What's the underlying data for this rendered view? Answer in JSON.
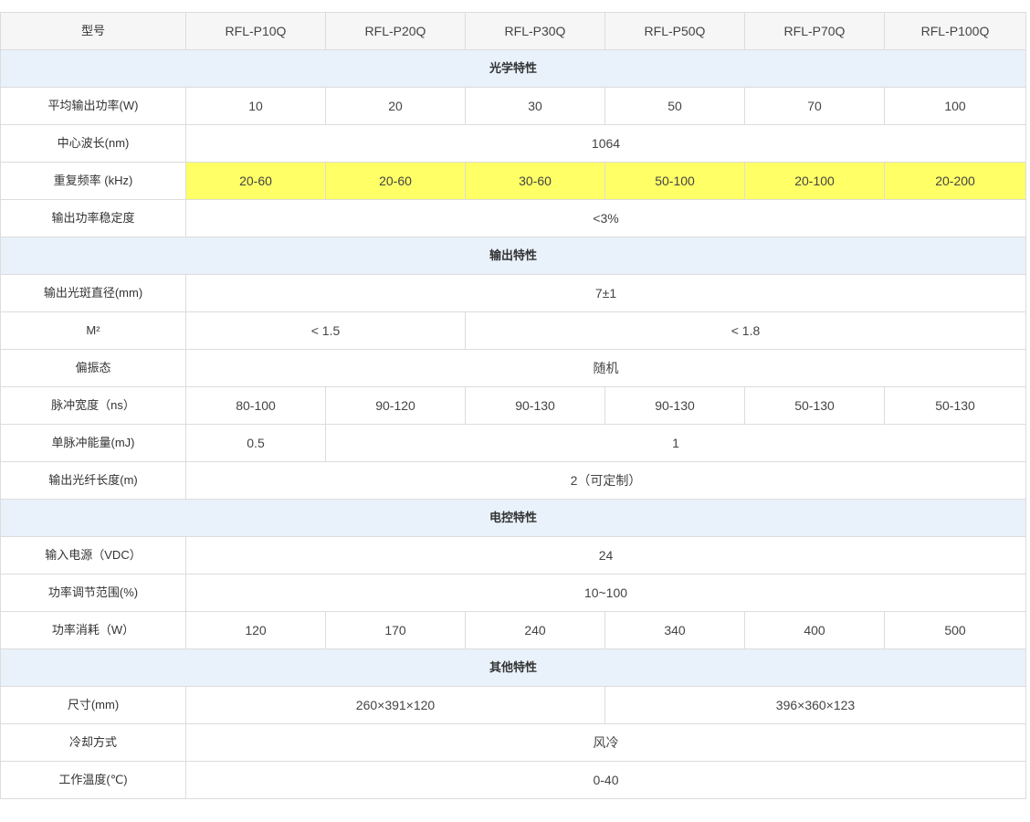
{
  "header": {
    "label": "型号",
    "models": [
      "RFL-P10Q",
      "RFL-P20Q",
      "RFL-P30Q",
      "RFL-P50Q",
      "RFL-P70Q",
      "RFL-P100Q"
    ]
  },
  "sections": {
    "optical": "光学特性",
    "output": "输出特性",
    "electrical": "电控特性",
    "other": "其他特性"
  },
  "rows": {
    "avg_power": {
      "label": "平均输出功率(W)",
      "values": [
        "10",
        "20",
        "30",
        "50",
        "70",
        "100"
      ]
    },
    "center_wavelength": {
      "label": "中心波长(nm)",
      "value": "1064"
    },
    "rep_rate": {
      "label": "重复频率 (kHz)",
      "values": [
        "20-60",
        "20-60",
        "30-60",
        "50-100",
        "20-100",
        "20-200"
      ]
    },
    "power_stability": {
      "label": "输出功率稳定度",
      "value": "<3%"
    },
    "spot_diameter": {
      "label": "输出光斑直径(mm)",
      "value": "7±1"
    },
    "m2": {
      "label": "M²",
      "values": [
        "< 1.5",
        "< 1.8"
      ]
    },
    "polarization": {
      "label": "偏振态",
      "value": "随机"
    },
    "pulse_width": {
      "label": "脉冲宽度（ns）",
      "values": [
        "80-100",
        "90-120",
        "90-130",
        "90-130",
        "50-130",
        "50-130"
      ]
    },
    "pulse_energy": {
      "label": "单脉冲能量(mJ)",
      "values": [
        "0.5",
        "1"
      ]
    },
    "fiber_length": {
      "label": "输出光纤长度(m)",
      "value": "2（可定制）"
    },
    "input_power": {
      "label": "输入电源（VDC）",
      "value": "24"
    },
    "power_range": {
      "label": "功率调节范围(%)",
      "value": "10~100"
    },
    "power_consumption": {
      "label": "功率消耗（W）",
      "values": [
        "120",
        "170",
        "240",
        "340",
        "400",
        "500"
      ]
    },
    "dimensions": {
      "label": "尺寸(mm)",
      "values": [
        "260×391×120",
        "396×360×123"
      ]
    },
    "cooling": {
      "label": "冷却方式",
      "value": "风冷"
    },
    "operating_temp": {
      "label": "工作温度(℃)",
      "value": "0-40"
    }
  },
  "colors": {
    "highlight": "#ffff66",
    "section_background": "#e9f1fb",
    "header_background": "#f6f6f6",
    "border": "#dcdcdc"
  }
}
